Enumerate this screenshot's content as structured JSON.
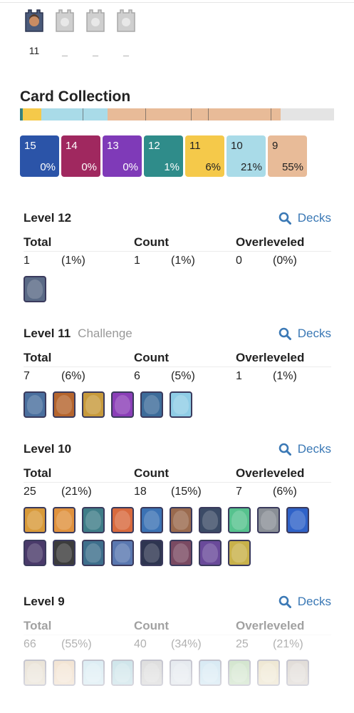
{
  "towers": [
    {
      "label": "11",
      "active": true
    },
    {
      "label": "_",
      "active": false
    },
    {
      "label": "_",
      "active": false
    },
    {
      "label": "_",
      "active": false
    }
  ],
  "card_collection": {
    "title": "Card Collection",
    "tiles": [
      {
        "level": "15",
        "percent": "0%",
        "bg": "#2b54a8",
        "fg": "#ffffff"
      },
      {
        "level": "14",
        "percent": "0%",
        "bg": "#a0285f",
        "fg": "#ffffff"
      },
      {
        "level": "13",
        "percent": "0%",
        "bg": "#7f3ab8",
        "fg": "#ffffff"
      },
      {
        "level": "12",
        "percent": "1%",
        "bg": "#2f8c8a",
        "fg": "#ffffff"
      },
      {
        "level": "11",
        "percent": "6%",
        "bg": "#f5c94a",
        "fg": "#222222"
      },
      {
        "level": "10",
        "percent": "21%",
        "bg": "#a9dbe8",
        "fg": "#222222"
      },
      {
        "level": "9",
        "percent": "55%",
        "bg": "#e8bb98",
        "fg": "#222222"
      }
    ]
  },
  "sections": [
    {
      "level": "Level 12",
      "tag": "",
      "decks": "Decks",
      "headers": [
        "Total",
        "Count",
        "Overleveled"
      ],
      "total": "1",
      "total_pct": "(1%)",
      "count": "1",
      "count_pct": "(1%)",
      "over": "0",
      "over_pct": "(0%)",
      "card_colors": [
        "#5a6a86"
      ]
    },
    {
      "level": "Level 11",
      "tag": "Challenge",
      "decks": "Decks",
      "headers": [
        "Total",
        "Count",
        "Overleveled"
      ],
      "total": "7",
      "total_pct": "(6%)",
      "count": "6",
      "count_pct": "(5%)",
      "over": "1",
      "over_pct": "(1%)",
      "card_colors": [
        "#4a6f9e",
        "#b5652e",
        "#c79a3c",
        "#8b3fb8",
        "#3d6c9a",
        "#8fcde6"
      ]
    },
    {
      "level": "Level 10",
      "tag": "",
      "decks": "Decks",
      "headers": [
        "Total",
        "Count",
        "Overleveled"
      ],
      "total": "25",
      "total_pct": "(21%)",
      "count": "18",
      "count_pct": "(15%)",
      "over": "7",
      "over_pct": "(6%)",
      "card_colors": [
        "#d89a3a",
        "#e0923e",
        "#3f7d88",
        "#d86a3e",
        "#3b72b4",
        "#9a6a4e",
        "#3b4b66",
        "#56c28e",
        "#8a8f96",
        "#2f62c8",
        "#4a3a6a",
        "#3c3c3c",
        "#3e6f8c",
        "#5a78b0",
        "#2e3550",
        "#7a4a62",
        "#6a4a9a",
        "#c8b14a"
      ]
    },
    {
      "level": "Level 9",
      "tag": "",
      "decks": "Decks",
      "headers": [
        "Total",
        "Count",
        "Overleveled"
      ],
      "total": "66",
      "total_pct": "(55%)",
      "count": "40",
      "count_pct": "(34%)",
      "over": "25",
      "over_pct": "(21%)",
      "card_colors": [
        "#b8a27a",
        "#d6a46a",
        "#8ac4d8",
        "#5aa6b8",
        "#8e8e8e",
        "#a8b8c8",
        "#7ab8d8",
        "#6aa85a",
        "#c8b06a",
        "#9a8a7a"
      ]
    }
  ],
  "colors": {
    "accent": "#3a78b5",
    "muted": "#999999"
  }
}
